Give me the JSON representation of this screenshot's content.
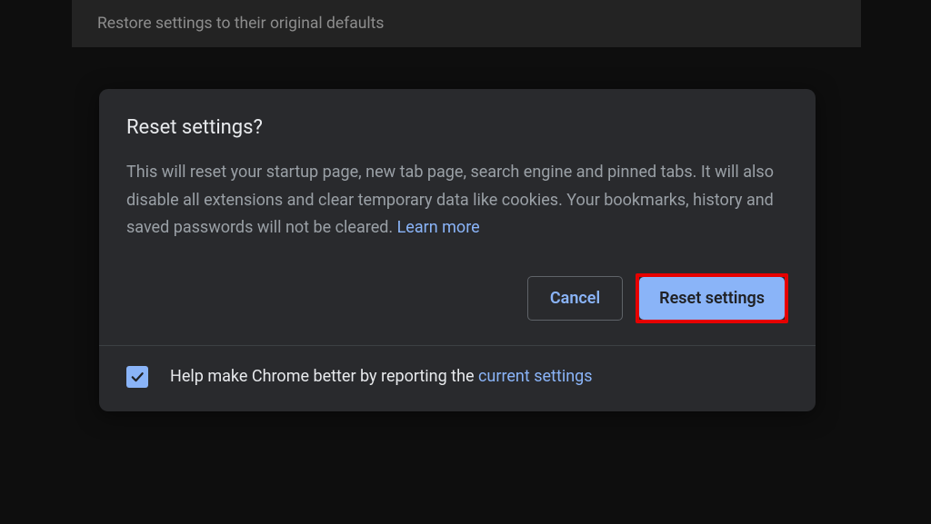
{
  "background": {
    "row_text": "Restore settings to their original defaults"
  },
  "dialog": {
    "title": "Reset settings?",
    "body_text": "This will reset your startup page, new tab page, search engine and pinned tabs. It will also disable all extensions and clear temporary data like cookies. Your bookmarks, history and saved passwords will not be cleared. ",
    "learn_more": "Learn more",
    "cancel_label": "Cancel",
    "confirm_label": "Reset settings",
    "footer_prefix": "Help make Chrome better by reporting the ",
    "footer_link": "current settings",
    "checkbox_checked": true
  }
}
